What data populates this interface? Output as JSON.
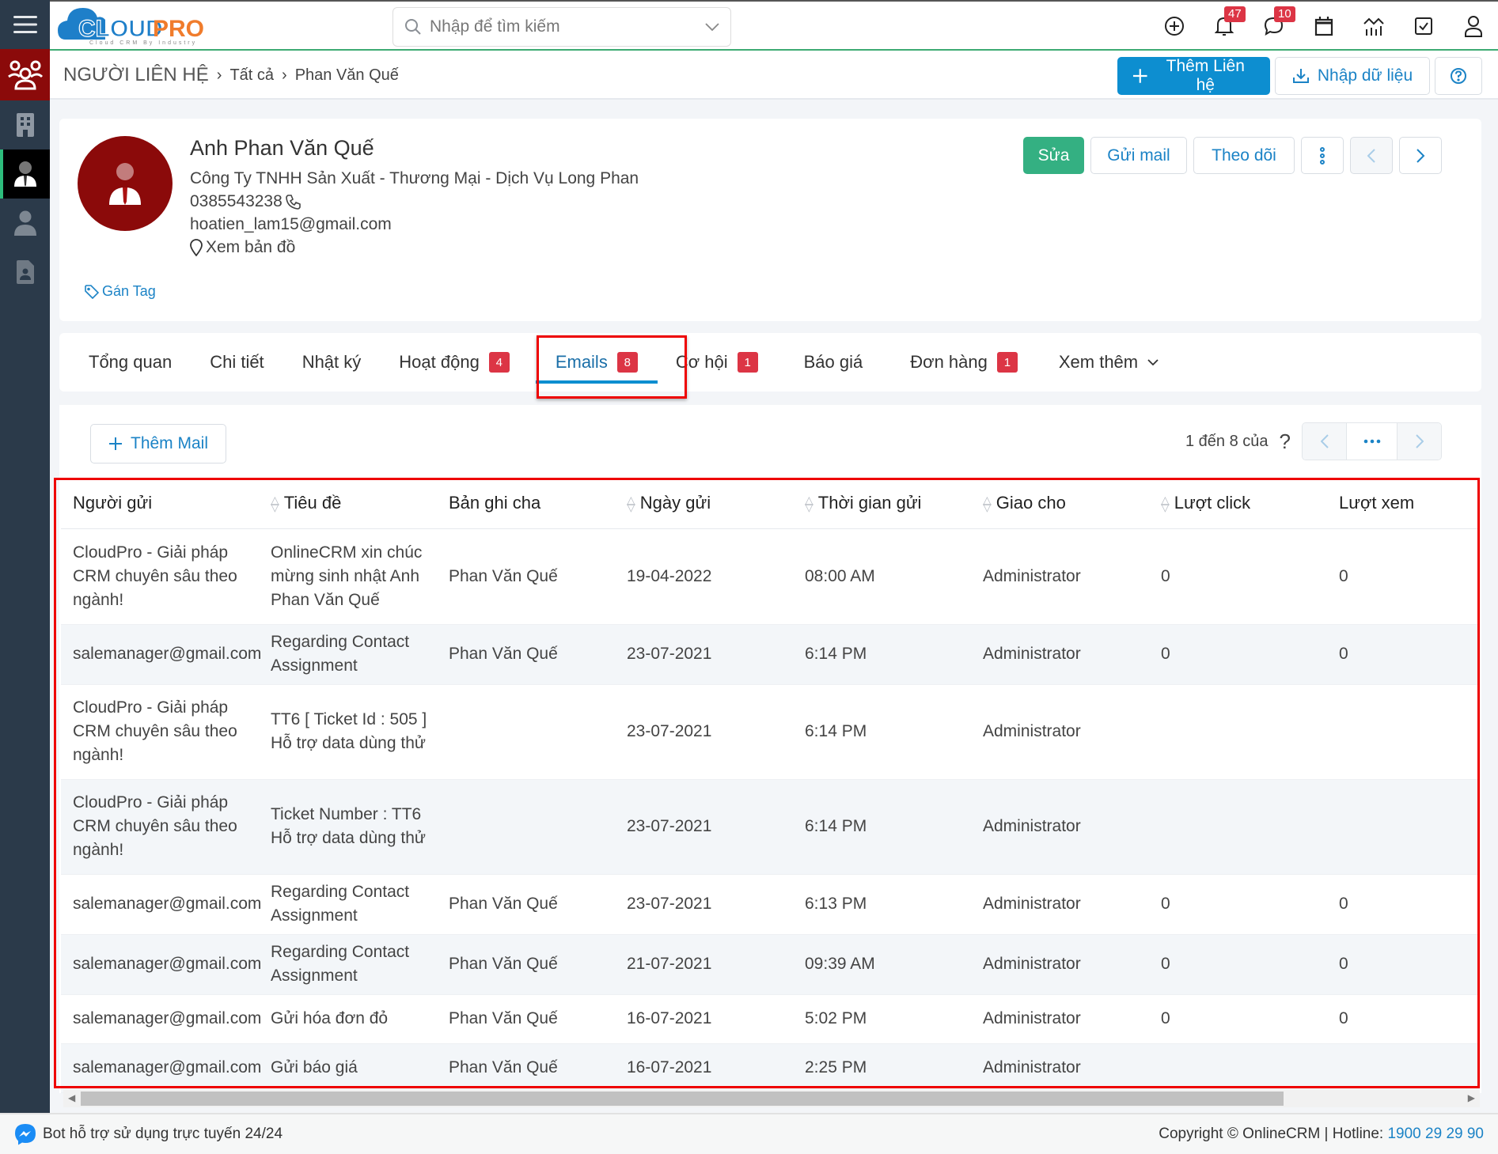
{
  "app": {
    "logo_text_cloud": "CLOUD",
    "logo_text_pro": "PRO",
    "logo_tagline": "Cloud CRM By Industry",
    "search_placeholder": "Nhập để tìm kiếm",
    "notifications_count": "47",
    "messages_count": "10",
    "colors": {
      "brand_blue": "#0d8ed0",
      "brand_orange": "#f07c2c",
      "success": "#34b082",
      "danger": "#dc3545",
      "sidebar": "#2b3a4a",
      "module_red": "#8b0a0a"
    }
  },
  "sidebar": {
    "items": [
      {
        "icon": "menu-icon"
      },
      {
        "icon": "contacts-group-icon",
        "active_module": true
      },
      {
        "icon": "building-icon"
      },
      {
        "icon": "contact-person-icon",
        "active": true
      },
      {
        "icon": "user-icon"
      },
      {
        "icon": "contact-document-icon"
      }
    ]
  },
  "header": {
    "breadcrumb": [
      "NGƯỜI LIÊN HỆ",
      "Tất cả",
      "Phan Văn Quế"
    ],
    "add_contact_label": "Thêm Liên hệ",
    "import_label": "Nhập dữ liệu"
  },
  "contact": {
    "name": "Anh Phan Văn Quế",
    "company": "Công Ty TNHH Sản Xuất - Thương Mại - Dịch Vụ Long Phan",
    "phone": "0385543238",
    "email": "hoatien_lam15@gmail.com",
    "map_label": "Xem bản đồ",
    "tag_label": "Gán Tag",
    "actions": {
      "edit": "Sửa",
      "send_mail": "Gửi mail",
      "follow": "Theo dõi"
    }
  },
  "tabs": [
    {
      "label": "Tổng quan"
    },
    {
      "label": "Chi tiết"
    },
    {
      "label": "Nhật ký"
    },
    {
      "label": "Hoạt động",
      "count": "4"
    },
    {
      "label": "Emails",
      "count": "8",
      "active": true
    },
    {
      "label": "Cơ hội",
      "count": "1"
    },
    {
      "label": "Báo giá"
    },
    {
      "label": "Đơn hàng",
      "count": "1"
    },
    {
      "label": "Xem thêm",
      "dropdown": true
    }
  ],
  "emails": {
    "add_label": "Thêm Mail",
    "pager_text": "1 đến 8 của",
    "pager_total": "?",
    "columns": [
      "Người gửi",
      "Tiêu đề",
      "Bản ghi cha",
      "Ngày gửi",
      "Thời gian gửi",
      "Giao cho",
      "Lượt click",
      "Lượt xem"
    ],
    "rows": [
      {
        "sender": "CloudPro - Giải pháp CRM chuyên sâu theo ngành!",
        "subject": "OnlineCRM xin chúc mừng sinh nhật Anh Phan Văn Quế",
        "parent": "Phan Văn Quế",
        "date": "19-04-2022",
        "time": "08:00 AM",
        "assigned": "Administrator",
        "clicks": "0",
        "views": "0"
      },
      {
        "sender": "salemanager@gmail.com",
        "subject": "Regarding Contact Assignment",
        "parent": "Phan Văn Quế",
        "date": "23-07-2021",
        "time": "6:14 PM",
        "assigned": "Administrator",
        "clicks": "0",
        "views": "0"
      },
      {
        "sender": "CloudPro - Giải pháp CRM chuyên sâu theo ngành!",
        "subject": "TT6 [ Ticket Id : 505 ] Hỗ trợ data dùng thử",
        "parent": "",
        "date": "23-07-2021",
        "time": "6:14 PM",
        "assigned": "Administrator",
        "clicks": "",
        "views": ""
      },
      {
        "sender": "CloudPro - Giải pháp CRM chuyên sâu theo ngành!",
        "subject": "Ticket Number : TT6 Hỗ trợ data dùng thử",
        "parent": "",
        "date": "23-07-2021",
        "time": "6:14 PM",
        "assigned": "Administrator",
        "clicks": "",
        "views": ""
      },
      {
        "sender": "salemanager@gmail.com",
        "subject": "Regarding Contact Assignment",
        "parent": "Phan Văn Quế",
        "date": "23-07-2021",
        "time": "6:13 PM",
        "assigned": "Administrator",
        "clicks": "0",
        "views": "0"
      },
      {
        "sender": "salemanager@gmail.com",
        "subject": "Regarding Contact Assignment",
        "parent": "Phan Văn Quế",
        "date": "21-07-2021",
        "time": "09:39 AM",
        "assigned": "Administrator",
        "clicks": "0",
        "views": "0"
      },
      {
        "sender": "salemanager@gmail.com",
        "subject": "Gửi hóa đơn đỏ",
        "parent": "Phan Văn Quế",
        "date": "16-07-2021",
        "time": "5:02 PM",
        "assigned": "Administrator",
        "clicks": "0",
        "views": "0"
      },
      {
        "sender": "salemanager@gmail.com",
        "subject": "Gửi báo giá",
        "parent": "Phan Văn Quế",
        "date": "16-07-2021",
        "time": "2:25 PM",
        "assigned": "Administrator",
        "clicks": "",
        "views": ""
      }
    ]
  },
  "footer": {
    "bot_text": "Bot hỗ trợ sử dụng trực tuyến 24/24",
    "copyright": "Copyright © OnlineCRM | Hotline: ",
    "hotline": "1900 29 29 90"
  }
}
